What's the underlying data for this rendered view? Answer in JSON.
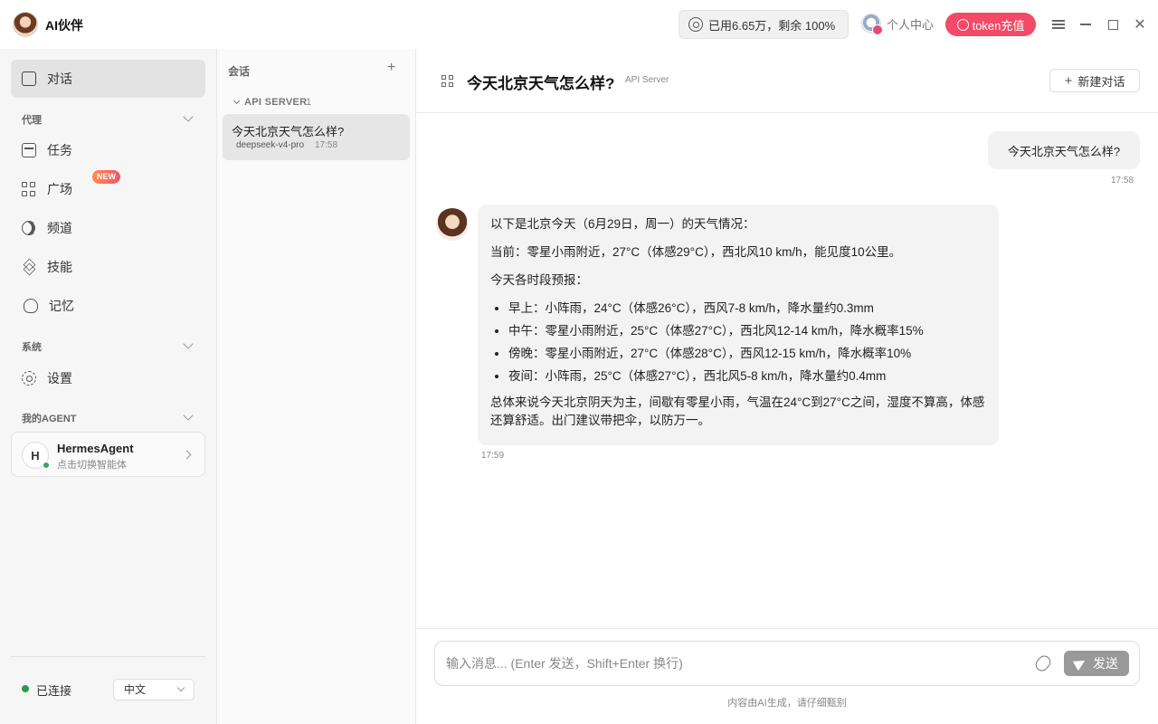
{
  "app": {
    "title": "AI伙伴"
  },
  "titlebar": {
    "usage": "已用6.65万，剩余 100%",
    "profile_label": "个人中心",
    "token_button": "token充值",
    "close_glyph": "✕"
  },
  "sidebar": {
    "chat": "对话",
    "section_agent": "代理",
    "tasks": "任务",
    "plaza": "广场",
    "new_badge": "NEW",
    "channels": "频道",
    "skills": "技能",
    "memory": "记忆",
    "section_system": "系统",
    "settings": "设置",
    "section_my_agent": "我的AGENT",
    "agent": {
      "initial": "H",
      "name": "HermesAgent",
      "subtitle": "点击切换智能体"
    },
    "status": "已连接",
    "status_color": "#2e9a4a",
    "language": "中文"
  },
  "sessions": {
    "title": "会话",
    "add_glyph": "+",
    "group": {
      "label": "API SERVER",
      "count": "1"
    },
    "items": [
      {
        "title": "今天北京天气怎么样?",
        "model": "deepseek-v4-pro",
        "time": "17:58"
      }
    ]
  },
  "main": {
    "title": "今天北京天气怎么样?",
    "tag": "API Server",
    "new_chat": "新建对话",
    "user_message": {
      "text": "今天北京天气怎么样?",
      "time": "17:58"
    },
    "bot_message": {
      "intro": "以下是北京今天（6月29日，周一）的天气情况：",
      "current": "当前：零星小雨附近，27°C（体感29°C），西北风10 km/h，能见度10公里。",
      "forecast_title": "今天各时段预报：",
      "forecast": [
        "早上：小阵雨，24°C（体感26°C），西风7-8 km/h，降水量约0.3mm",
        "中午：零星小雨附近，25°C（体感27°C），西北风12-14 km/h，降水概率15%",
        "傍晚：零星小雨附近，27°C（体感28°C），西风12-15 km/h，降水概率10%",
        "夜间：小阵雨，25°C（体感27°C），西北风5-8 km/h，降水量约0.4mm"
      ],
      "summary": "总体来说今天北京阴天为主，间歇有零星小雨，气温在24°C到27°C之间，湿度不算高，体感还算舒适。出门建议带把伞，以防万一。",
      "time": "17:59"
    },
    "composer": {
      "placeholder": "输入消息... (Enter 发送，Shift+Enter 换行)",
      "send": "发送"
    },
    "disclaimer": "内容由AI生成，请仔细甄别"
  },
  "colors": {
    "accent": "#f24a67",
    "active_nav": "#e3e3e3"
  }
}
